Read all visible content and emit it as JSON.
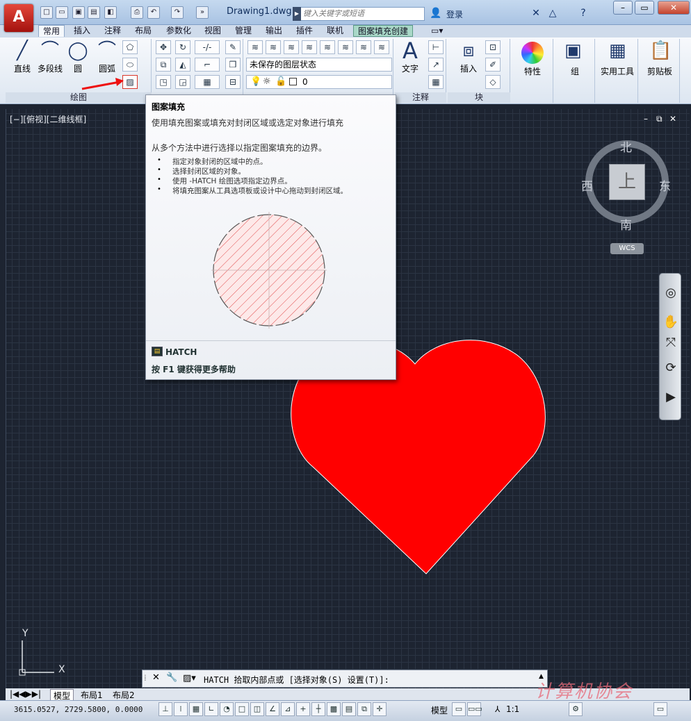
{
  "window": {
    "title": "Drawing1.dwg",
    "search_placeholder": "键入关键字或短语",
    "login": "登录"
  },
  "tabs": [
    "常用",
    "插入",
    "注释",
    "布局",
    "参数化",
    "视图",
    "管理",
    "输出",
    "插件",
    "联机",
    "图案填充创建"
  ],
  "draw_panel": {
    "title": "绘图",
    "buttons": [
      "直线",
      "多段线",
      "圆",
      "圆弧"
    ]
  },
  "layers": {
    "state": "未保存的图层状态",
    "current": "0"
  },
  "text_panel": {
    "big_label": "文字",
    "insert_label": "插入",
    "annot_title": "注释",
    "block_title": "块"
  },
  "right_buttons": [
    "特性",
    "组",
    "实用工具",
    "剪贴板"
  ],
  "viewport": {
    "label": "[−][俯视][二维线框]"
  },
  "viewcube": {
    "north": "北",
    "south": "南",
    "east": "东",
    "west": "西",
    "face": "上",
    "wcs": "WCS"
  },
  "tooltip": {
    "title": "图案填充",
    "desc": "使用填充图案或填充对封闭区域或选定对象进行填充",
    "desc2": "从多个方法中进行选择以指定图案填充的边界。",
    "bullets": [
      "指定对象封闭的区域中的点。",
      "选择封闭区域的对象。",
      "使用 -HATCH 绘图选项指定边界点。",
      "将填充图案从工具选项板或设计中心拖动到封闭区域。"
    ],
    "command": "HATCH",
    "help": "按 F1 键获得更多帮助"
  },
  "command_line": {
    "text": "HATCH 拾取内部点或 [选择对象(S) 设置(T)]:"
  },
  "layout_tabs": [
    "模型",
    "布局1",
    "布局2"
  ],
  "status": {
    "coords": "3615.0527, 2729.5800, 0.0000",
    "model": "模型",
    "scale": "1:1"
  },
  "watermark": "计算机协会",
  "heart_color": "#ff0000"
}
